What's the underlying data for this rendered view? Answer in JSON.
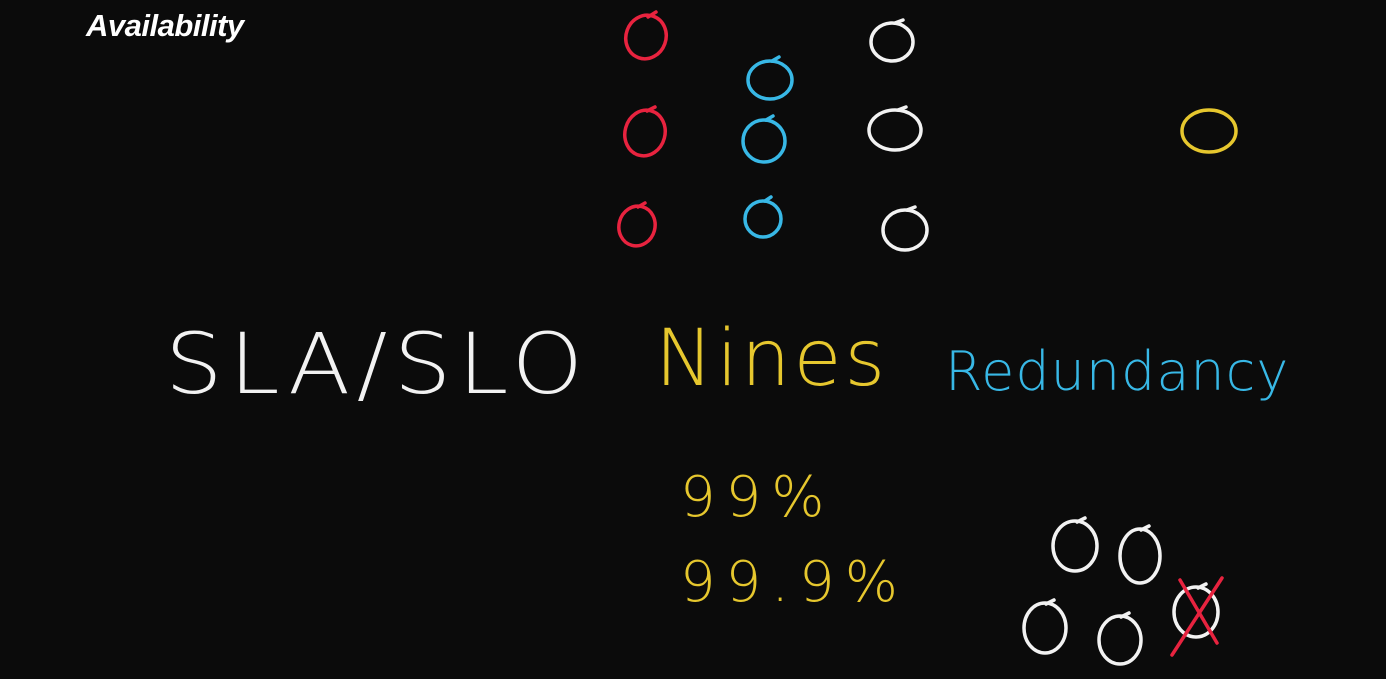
{
  "header": {
    "title": "Availability",
    "title_color": "#ffffff"
  },
  "topics": {
    "sla_slo": {
      "label": "SLA/SLO",
      "color": "#f2f2f2"
    },
    "nines": {
      "label": "Nines",
      "color": "#e6c72e"
    },
    "redundancy": {
      "label": "Redundancy",
      "color": "#38b8e6"
    }
  },
  "nines_examples": {
    "first": "99%",
    "second": "99.9%",
    "color": "#e6c72e"
  },
  "colors": {
    "red": "#e8233f",
    "blue": "#38b8e6",
    "white": "#f2f2f2",
    "yellow": "#e6c72e",
    "background": "#0b0b0b"
  }
}
